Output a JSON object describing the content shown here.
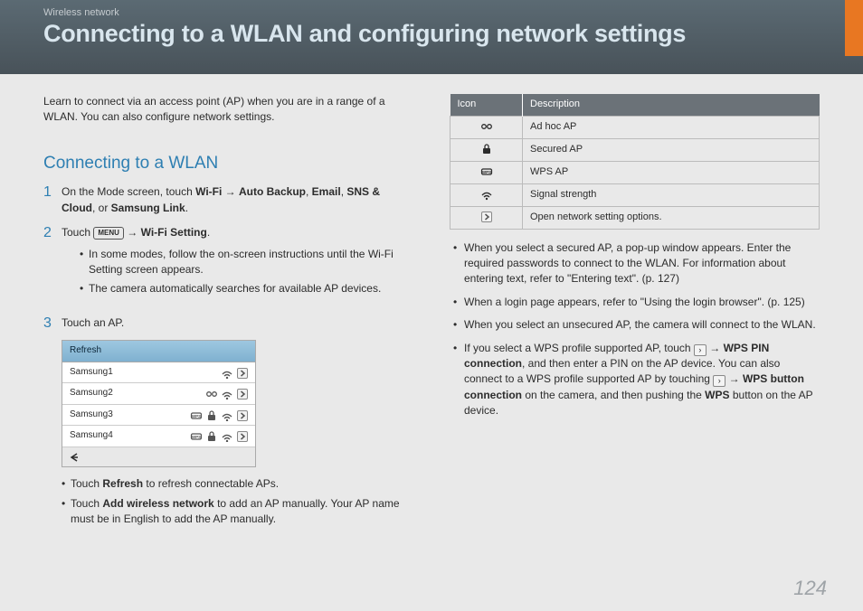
{
  "header": {
    "breadcrumb": "Wireless network",
    "title": "Connecting to a WLAN and configuring network settings"
  },
  "pageNumber": "124",
  "intro": "Learn to connect via an access point (AP) when you are in a range of a WLAN. You can also configure network settings.",
  "section": {
    "heading": "Connecting to a WLAN",
    "step1": {
      "pre": "On the Mode screen, touch ",
      "b1": "Wi-Fi",
      "arrow": " → ",
      "b2": "Auto Backup",
      "sep": ", ",
      "b3": "Email",
      "sep2": ", ",
      "b4": "SNS & Cloud",
      "sep3": ", or ",
      "b5": "Samsung Link",
      "post": "."
    },
    "step2": {
      "pre": "Touch ",
      "menu": "MENU",
      "arrow": " → ",
      "b1": "Wi-Fi Setting",
      "post": ".",
      "bullets": [
        "In some modes, follow the on-screen instructions until the Wi-Fi Setting screen appears.",
        "The camera automatically searches for available AP devices."
      ]
    },
    "step3": {
      "text": "Touch an AP.",
      "refreshLabel": "Refresh",
      "aps": [
        "Samsung1",
        "Samsung2",
        "Samsung3",
        "Samsung4"
      ],
      "afterBullets": {
        "b1pre": "Touch ",
        "b1bold": "Refresh",
        "b1post": " to refresh connectable APs.",
        "b2pre": "Touch ",
        "b2bold": "Add wireless network",
        "b2post": " to add an AP manually. Your AP name must be in English to add the AP manually."
      }
    }
  },
  "iconTable": {
    "headers": [
      "Icon",
      "Description"
    ],
    "rows": [
      {
        "icon": "adhoc",
        "desc": "Ad hoc AP"
      },
      {
        "icon": "lock",
        "desc": "Secured AP"
      },
      {
        "icon": "wps",
        "desc": "WPS AP"
      },
      {
        "icon": "wifi",
        "desc": "Signal strength"
      },
      {
        "icon": "chev",
        "desc": "Open network setting options."
      }
    ]
  },
  "rightBullets": {
    "b1": "When you select a secured AP, a pop-up window appears. Enter the required passwords to connect to the WLAN. For information about entering text, refer to \"Entering text\". (p. 127)",
    "b2": "When a login page appears, refer to \"Using the login browser\". (p. 125)",
    "b3": "When you select an unsecured AP, the camera will connect to the WLAN.",
    "b4": {
      "pre": "If you select a WPS profile supported AP, touch ",
      "arrow": " → ",
      "bold1": "WPS PIN connection",
      "mid1": ", and then enter a PIN on the AP device. You can also connect to a WPS profile supported AP by touching ",
      "bold2": "WPS button connection",
      "mid2": " on the camera, and then pushing the ",
      "bold3": "WPS",
      "post": " button on the AP device."
    }
  }
}
